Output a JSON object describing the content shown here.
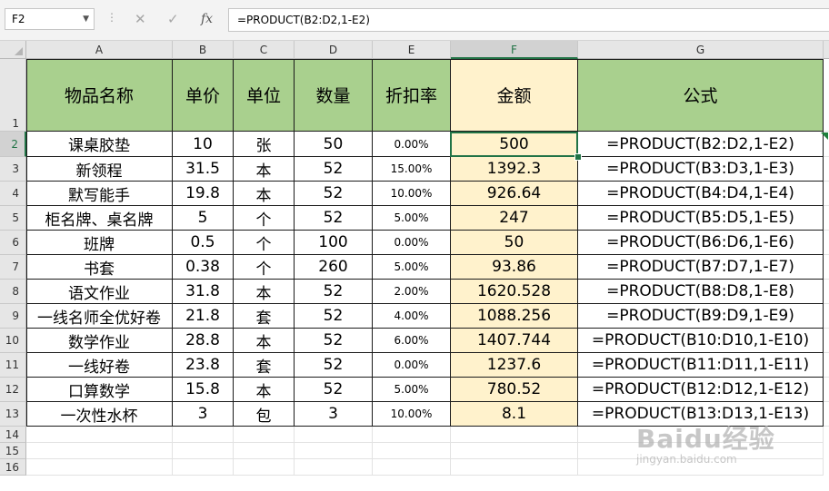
{
  "formula_bar": {
    "name_box": "F2",
    "cancel_glyph": "✕",
    "enter_glyph": "✓",
    "fx_label": "fx",
    "formula": "=PRODUCT(B2:D2,1-E2)"
  },
  "columns": [
    "A",
    "B",
    "C",
    "D",
    "E",
    "F",
    "G"
  ],
  "rows": [
    "1",
    "2",
    "3",
    "4",
    "5",
    "6",
    "7",
    "8",
    "9",
    "10",
    "11",
    "12",
    "13",
    "14",
    "15",
    "16"
  ],
  "header": [
    "物品名称",
    "单价",
    "单位",
    "数量",
    "折扣率",
    "金额",
    "公式"
  ],
  "table": [
    [
      "课桌胶垫",
      "10",
      "张",
      "50",
      "0.00%",
      "500",
      "=PRODUCT(B2:D2,1-E2)"
    ],
    [
      "新领程",
      "31.5",
      "本",
      "52",
      "15.00%",
      "1392.3",
      "=PRODUCT(B3:D3,1-E3)"
    ],
    [
      "默写能手",
      "19.8",
      "本",
      "52",
      "10.00%",
      "926.64",
      "=PRODUCT(B4:D4,1-E4)"
    ],
    [
      "柜名牌、桌名牌",
      "5",
      "个",
      "52",
      "5.00%",
      "247",
      "=PRODUCT(B5:D5,1-E5)"
    ],
    [
      "班牌",
      "0.5",
      "个",
      "100",
      "0.00%",
      "50",
      "=PRODUCT(B6:D6,1-E6)"
    ],
    [
      "书套",
      "0.38",
      "个",
      "260",
      "5.00%",
      "93.86",
      "=PRODUCT(B7:D7,1-E7)"
    ],
    [
      "语文作业",
      "31.8",
      "本",
      "52",
      "2.00%",
      "1620.528",
      "=PRODUCT(B8:D8,1-E8)"
    ],
    [
      "一线名师全优好卷",
      "21.8",
      "套",
      "52",
      "4.00%",
      "1088.256",
      "=PRODUCT(B9:D9,1-E9)"
    ],
    [
      "数学作业",
      "28.8",
      "本",
      "52",
      "6.00%",
      "1407.744",
      "=PRODUCT(B10:D10,1-E10)"
    ],
    [
      "一线好卷",
      "23.8",
      "套",
      "52",
      "0.00%",
      "1237.6",
      "=PRODUCT(B11:D11,1-E11)"
    ],
    [
      "口算数学",
      "15.8",
      "本",
      "52",
      "5.00%",
      "780.52",
      "=PRODUCT(B12:D12,1-E12)"
    ],
    [
      "一次性水杯",
      "3",
      "包",
      "3",
      "10.00%",
      "8.1",
      "=PRODUCT(B13:D13,1-E13)"
    ]
  ],
  "selection": {
    "cell": "F2",
    "column": "F",
    "row": "2"
  },
  "colors": {
    "header_green": "#a9d08e",
    "amount_yellow": "#fff2cc",
    "excel_green": "#217346"
  },
  "watermark": {
    "logo": "Baidu经验",
    "site": "jingyan.baidu.com"
  }
}
